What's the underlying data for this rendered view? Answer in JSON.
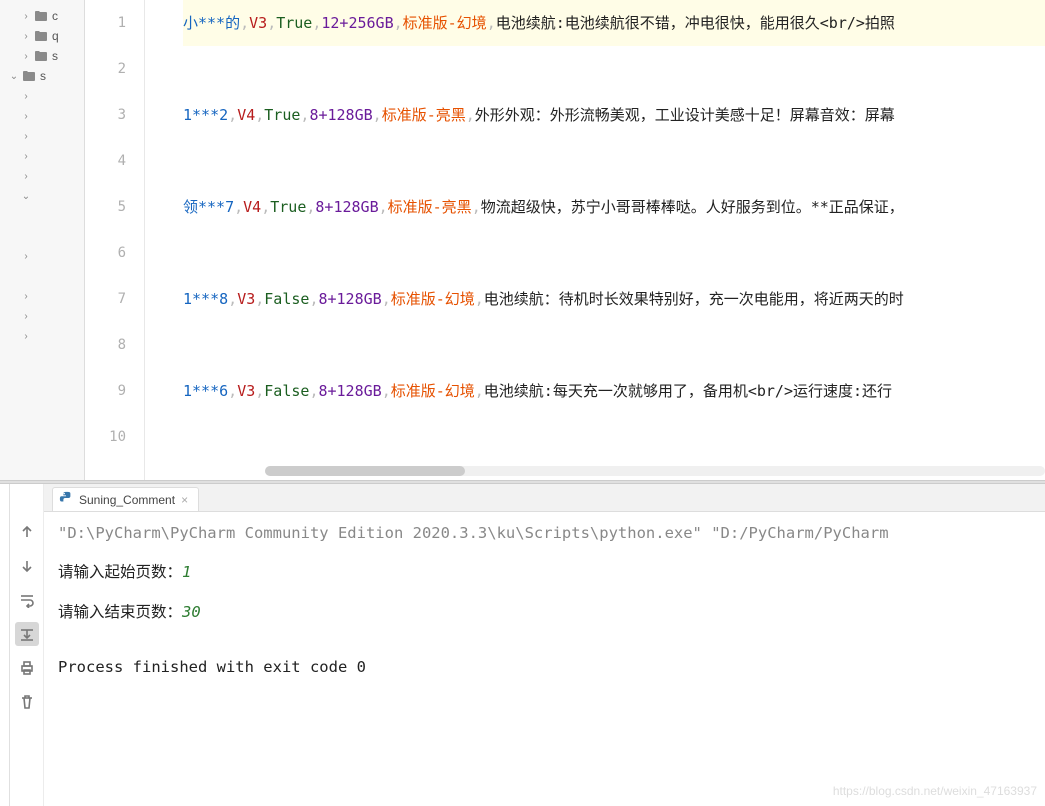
{
  "tree": {
    "items": [
      {
        "arrow": "›",
        "indent": 16,
        "label": "c"
      },
      {
        "arrow": "›",
        "indent": 16,
        "label": "q"
      },
      {
        "arrow": "›",
        "indent": 16,
        "label": "s"
      },
      {
        "arrow": "⌄",
        "indent": 4,
        "label": "s"
      },
      {
        "arrow": "›",
        "indent": 16,
        "label": ""
      },
      {
        "arrow": "›",
        "indent": 16,
        "label": ""
      },
      {
        "arrow": "›",
        "indent": 16,
        "label": ""
      },
      {
        "arrow": "›",
        "indent": 16,
        "label": ""
      },
      {
        "arrow": "›",
        "indent": 16,
        "label": ""
      },
      {
        "arrow": "⌄",
        "indent": 16,
        "label": ""
      },
      {
        "arrow": "",
        "indent": 16,
        "label": ""
      },
      {
        "arrow": "",
        "indent": 16,
        "label": ""
      },
      {
        "arrow": "›",
        "indent": 16,
        "label": ""
      },
      {
        "arrow": "",
        "indent": 16,
        "label": ""
      },
      {
        "arrow": "›",
        "indent": 16,
        "label": ""
      },
      {
        "arrow": "›",
        "indent": 16,
        "label": ""
      },
      {
        "arrow": "›",
        "indent": 16,
        "label": ""
      }
    ]
  },
  "editor": {
    "highlight_line": 1,
    "gutter": [
      "1",
      "2",
      "3",
      "4",
      "5",
      "6",
      "7",
      "8",
      "9",
      "10"
    ],
    "lines": [
      {
        "segs": [
          {
            "t": "小***的",
            "c": "t-blue"
          },
          {
            "t": ",",
            "c": "t-sep"
          },
          {
            "t": "V3",
            "c": "t-red"
          },
          {
            "t": ",",
            "c": "t-sep"
          },
          {
            "t": "True",
            "c": "t-green"
          },
          {
            "t": ",",
            "c": "t-sep"
          },
          {
            "t": "12+256GB",
            "c": "t-purple"
          },
          {
            "t": ",",
            "c": "t-sep"
          },
          {
            "t": "标准版-幻境",
            "c": "t-orange"
          },
          {
            "t": ",",
            "c": "t-sep"
          },
          {
            "t": "电池续航:电池续航很不错，冲电很快，能用很久<br/>拍照",
            "c": "t-black"
          }
        ]
      },
      {
        "segs": []
      },
      {
        "segs": [
          {
            "t": "1***2",
            "c": "t-blue"
          },
          {
            "t": ",",
            "c": "t-sep"
          },
          {
            "t": "V4",
            "c": "t-red"
          },
          {
            "t": ",",
            "c": "t-sep"
          },
          {
            "t": "True",
            "c": "t-green"
          },
          {
            "t": ",",
            "c": "t-sep"
          },
          {
            "t": "8+128GB",
            "c": "t-purple"
          },
          {
            "t": ",",
            "c": "t-sep"
          },
          {
            "t": "标准版-亮黑",
            "c": "t-orange"
          },
          {
            "t": ",",
            "c": "t-sep"
          },
          {
            "t": "外形外观：外形流畅美观，工业设计美感十足！屏幕音效：屏幕",
            "c": "t-black"
          }
        ]
      },
      {
        "segs": []
      },
      {
        "segs": [
          {
            "t": "领***7",
            "c": "t-blue"
          },
          {
            "t": ",",
            "c": "t-sep"
          },
          {
            "t": "V4",
            "c": "t-red"
          },
          {
            "t": ",",
            "c": "t-sep"
          },
          {
            "t": "True",
            "c": "t-green"
          },
          {
            "t": ",",
            "c": "t-sep"
          },
          {
            "t": "8+128GB",
            "c": "t-purple"
          },
          {
            "t": ",",
            "c": "t-sep"
          },
          {
            "t": "标准版-亮黑",
            "c": "t-orange"
          },
          {
            "t": ",",
            "c": "t-sep"
          },
          {
            "t": "物流超级快，苏宁小哥哥棒棒哒。人好服务到位。**正品保证，",
            "c": "t-black"
          }
        ]
      },
      {
        "segs": []
      },
      {
        "segs": [
          {
            "t": "1***8",
            "c": "t-blue"
          },
          {
            "t": ",",
            "c": "t-sep"
          },
          {
            "t": "V3",
            "c": "t-red"
          },
          {
            "t": ",",
            "c": "t-sep"
          },
          {
            "t": "False",
            "c": "t-green"
          },
          {
            "t": ",",
            "c": "t-sep"
          },
          {
            "t": "8+128GB",
            "c": "t-purple"
          },
          {
            "t": ",",
            "c": "t-sep"
          },
          {
            "t": "标准版-幻境",
            "c": "t-orange"
          },
          {
            "t": ",",
            "c": "t-sep"
          },
          {
            "t": "电池续航：待机时长效果特别好，充一次电能用，将近两天的时",
            "c": "t-black"
          }
        ]
      },
      {
        "segs": []
      },
      {
        "segs": [
          {
            "t": "1***6",
            "c": "t-blue"
          },
          {
            "t": ",",
            "c": "t-sep"
          },
          {
            "t": "V3",
            "c": "t-red"
          },
          {
            "t": ",",
            "c": "t-sep"
          },
          {
            "t": "False",
            "c": "t-green"
          },
          {
            "t": ",",
            "c": "t-sep"
          },
          {
            "t": "8+128GB",
            "c": "t-purple"
          },
          {
            "t": ",",
            "c": "t-sep"
          },
          {
            "t": "标准版-幻境",
            "c": "t-orange"
          },
          {
            "t": ",",
            "c": "t-sep"
          },
          {
            "t": "电池续航:每天充一次就够用了，备用机<br/>运行速度:还行",
            "c": "t-black"
          }
        ]
      },
      {
        "segs": []
      }
    ]
  },
  "run": {
    "tab_label": "Suning_Comment",
    "cmd": "\"D:\\PyCharm\\PyCharm Community Edition 2020.3.3\\ku\\Scripts\\python.exe\" \"D:/PyCharm/PyCharm",
    "prompt1": "请输入起始页数：",
    "val1": "1",
    "prompt2": "请输入结束页数：",
    "val2": "30",
    "finish": "Process finished with exit code 0"
  },
  "watermark": "https://blog.csdn.net/weixin_47163937"
}
